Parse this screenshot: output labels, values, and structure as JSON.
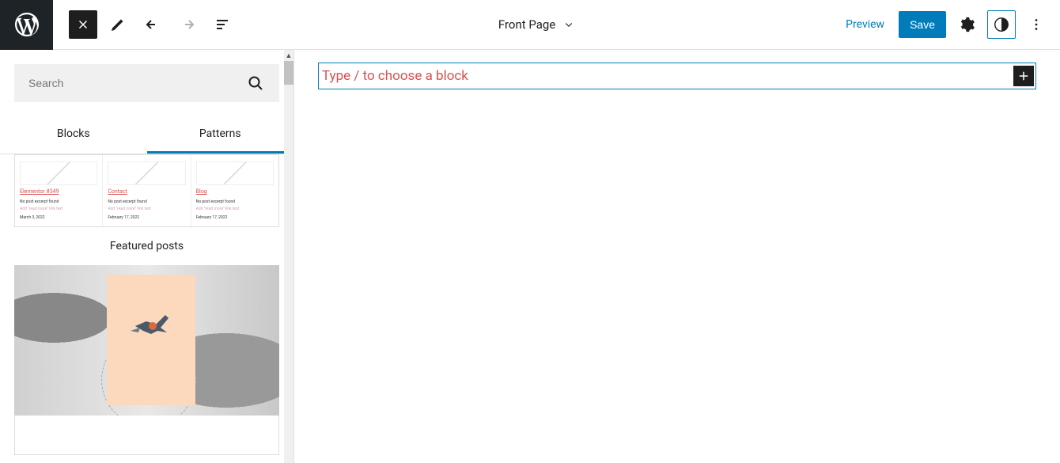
{
  "topbar": {
    "page_title": "Front Page",
    "preview": "Preview",
    "save": "Save"
  },
  "sidebar": {
    "search_placeholder": "Search",
    "tabs": {
      "blocks": "Blocks",
      "patterns": "Patterns"
    },
    "pattern_cards": [
      {
        "title": "Elementor #349",
        "excerpt": "No post excerpt found",
        "readmore": "Add \"read more\" link text",
        "date": "March 3, 2022"
      },
      {
        "title": "Contact",
        "excerpt": "No post excerpt found",
        "readmore": "Add \"read more\" link text",
        "date": "February 17, 2022"
      },
      {
        "title": "Blog",
        "excerpt": "No post excerpt found",
        "readmore": "Add \"read more\" link text",
        "date": "February 17, 2022"
      }
    ],
    "section_label": "Featured posts"
  },
  "canvas": {
    "block_placeholder": "Type / to choose a block"
  }
}
